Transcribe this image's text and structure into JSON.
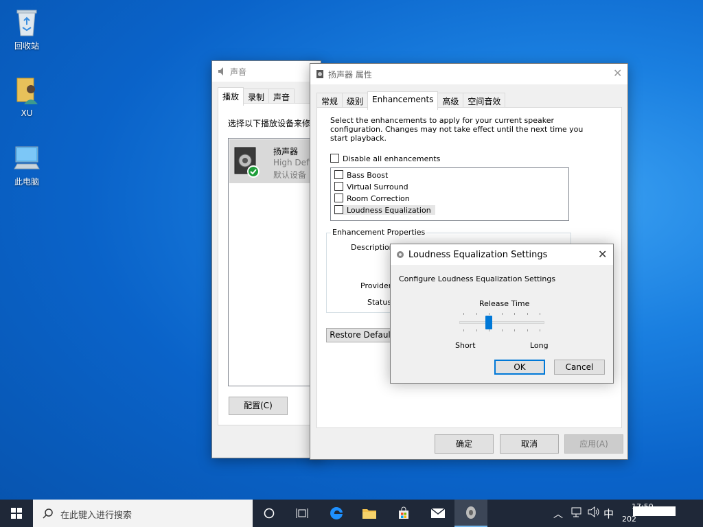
{
  "desktop": {
    "icons": [
      {
        "label": "回收站",
        "icon": "recycle-bin-icon"
      },
      {
        "label": "XU",
        "icon": "user-folder-icon"
      },
      {
        "label": "此电脑",
        "icon": "computer-icon"
      }
    ]
  },
  "sound_window": {
    "title": "声音",
    "tabs": [
      "播放",
      "录制",
      "声音"
    ],
    "instruction": "选择以下播放设备来修",
    "device": {
      "name": "扬声器",
      "driver": "High Defi",
      "status": "默认设备"
    },
    "configure_button": "配置(C)"
  },
  "speaker_props": {
    "title": "扬声器 属性",
    "tabs": [
      "常规",
      "级别",
      "Enhancements",
      "高级",
      "空间音效"
    ],
    "description": "Select the enhancements to apply for your current speaker configuration. Changes may not take effect until the next time you start playback.",
    "disable_all": "Disable all enhancements",
    "enhancements": [
      "Bass Boost",
      "Virtual Surround",
      "Room Correction",
      "Loudness Equalization"
    ],
    "properties_group": "Enhancement Properties",
    "description_label": "Description:",
    "provider_label": "Provider:",
    "status_label": "Status:",
    "restore_button": "Restore Defaults",
    "ok_button": "确定",
    "cancel_button": "取消",
    "apply_button": "应用(A)"
  },
  "loudness_dialog": {
    "title": "Loudness Equalization Settings",
    "subtitle": "Configure Loudness Equalization Settings",
    "slider_label": "Release Time",
    "slider_min_label": "Short",
    "slider_max_label": "Long",
    "slider_value_fraction": 0.33,
    "ok_button": "OK",
    "cancel_button": "Cancel"
  },
  "taskbar": {
    "search_placeholder": "在此键入进行搜索",
    "ime": "中",
    "time": "17:50",
    "date": "202"
  },
  "colors": {
    "accent": "#0078d7",
    "taskbar": "#1f2838"
  }
}
